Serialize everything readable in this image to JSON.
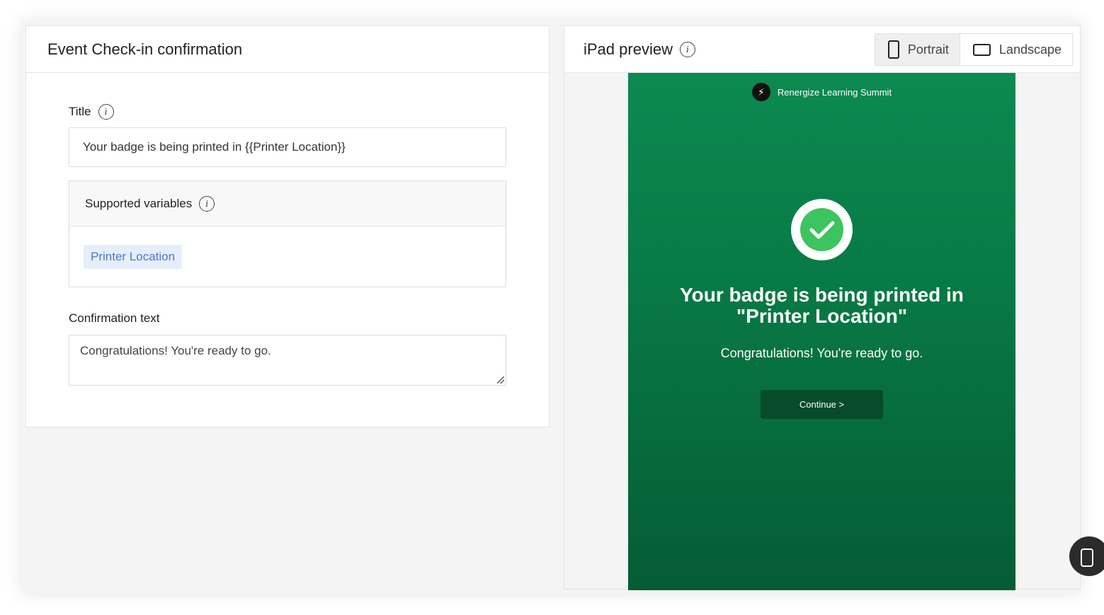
{
  "left": {
    "title": "Event Check-in confirmation",
    "title_field": {
      "label": "Title",
      "value": "Your badge is being printed in {{Printer Location}}"
    },
    "supported_variables": {
      "label": "Supported variables",
      "items": [
        "Printer Location"
      ]
    },
    "confirmation_field": {
      "label": "Confirmation text",
      "value": "Congratulations! You're ready to go."
    }
  },
  "right": {
    "title": "iPad preview",
    "orientation": {
      "portrait_label": "Portrait",
      "landscape_label": "Landscape",
      "selected": "Portrait"
    },
    "preview": {
      "brand": "Renergize Learning Summit",
      "heading": "Your badge is being printed in \"Printer Location\"",
      "subtext": "Congratulations! You're ready to go.",
      "button_label": "Continue  >"
    }
  },
  "colors": {
    "preview_bg": "#0b8a50",
    "check_green": "#3cc45f",
    "chip_text": "#4a78c9"
  }
}
